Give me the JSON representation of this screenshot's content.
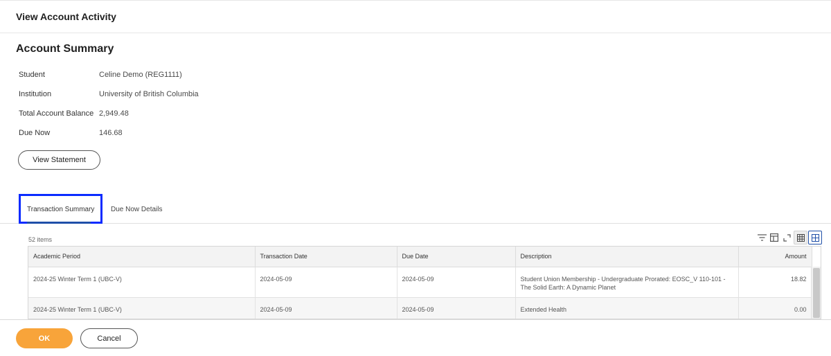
{
  "header": {
    "title": "View Account Activity"
  },
  "summary": {
    "title": "Account Summary",
    "fields": [
      {
        "label": "Student",
        "value": "Celine Demo (REG1111)"
      },
      {
        "label": "Institution",
        "value": "University of British Columbia"
      },
      {
        "label": "Total Account Balance",
        "value": "2,949.48"
      },
      {
        "label": "Due Now",
        "value": "146.68"
      }
    ],
    "view_statement_label": "View Statement"
  },
  "tabs": [
    {
      "label": "Transaction Summary",
      "active": true
    },
    {
      "label": "Due Now Details",
      "active": false
    }
  ],
  "grid": {
    "item_count": "52 items",
    "toolbar_icons": [
      "filter-icon",
      "column-chooser-icon",
      "expand-icon",
      "table-view-icon",
      "grid-view-icon"
    ],
    "columns": [
      "Academic Period",
      "Transaction Date",
      "Due Date",
      "Description",
      "Amount"
    ],
    "rows": [
      {
        "academic_period": "2024-25 Winter Term 1 (UBC-V)",
        "transaction_date": "2024-05-09",
        "due_date": "2024-05-09",
        "description": "Student Union Membership - Undergraduate Prorated: EOSC_V 110-101 - The Solid Earth: A Dynamic Planet",
        "amount": "18.82"
      },
      {
        "academic_period": "2024-25 Winter Term 1 (UBC-V)",
        "transaction_date": "2024-05-09",
        "due_date": "2024-05-09",
        "description": "Extended Health",
        "amount": "0.00"
      }
    ]
  },
  "footer": {
    "ok_label": "OK",
    "cancel_label": "Cancel"
  },
  "colors": {
    "accent_orange": "#f8a43a",
    "highlight_blue": "#0a2bff",
    "tab_underline": "#1f4fa8"
  }
}
